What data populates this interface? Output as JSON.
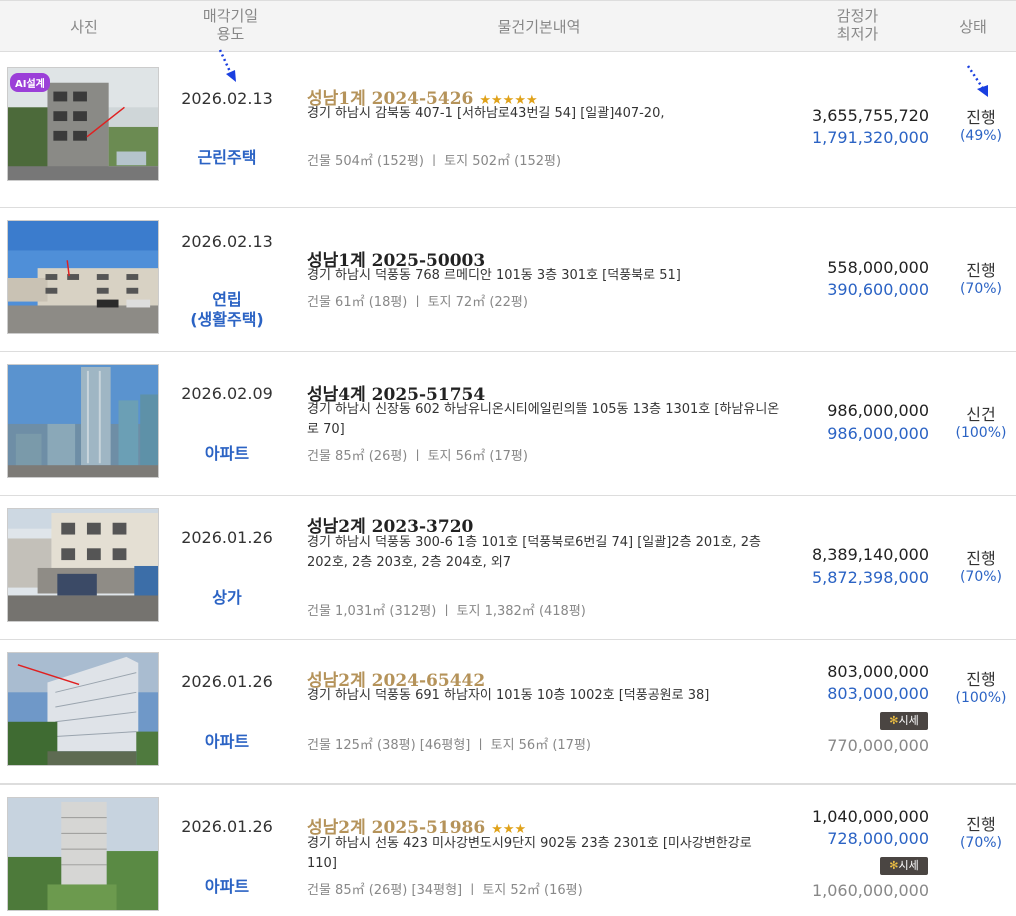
{
  "header": {
    "photo": "사진",
    "date_line1": "매각기일",
    "date_line2": "용도",
    "basic": "물건기본내역",
    "price_line1": "감정가",
    "price_line2": "최저가",
    "status": "상태"
  },
  "listings": [
    {
      "badge": "AI설계",
      "date": "2026.02.13",
      "usage": "근린주택",
      "case": "성남1계 2024-5426",
      "stars": "★★★★★",
      "address": "경기 하남시 감북동 407-1 [서하남로43번길 54]  [일괄]407-20,",
      "area": "건물 504㎡ (152평)   ㅣ  토지 502㎡ (152평)",
      "appraisal": "3,655,755,720",
      "min_price": "1,791,320,000",
      "status": "진행",
      "percent": "(49%)"
    },
    {
      "date": "2026.02.13",
      "usage_line1": "연립",
      "usage_line2": "(생활주택)",
      "case": "성남1계 2025-50003",
      "address": "경기 하남시 덕풍동 768 르메디안 101동 3층 301호 [덕풍북로 51]",
      "area": "건물 61㎡ (18평)   ㅣ  토지 72㎡ (22평)",
      "appraisal": "558,000,000",
      "min_price": "390,600,000",
      "status": "진행",
      "percent": "(70%)"
    },
    {
      "date": "2026.02.09",
      "usage": "아파트",
      "case": "성남4계 2025-51754",
      "address": "경기 하남시 신장동 602 하남유니온시티에일린의뜰 105동 13층 1301호 [하남유니온로 70]",
      "area": "건물 85㎡ (26평)   ㅣ  토지 56㎡ (17평)",
      "appraisal": "986,000,000",
      "min_price": "986,000,000",
      "status": "신건",
      "percent": "(100%)"
    },
    {
      "date": "2026.01.26",
      "usage": "상가",
      "case": "성남2계 2023-3720",
      "address": "경기 하남시 덕풍동 300-6 1층 101호 [덕풍북로6번길 74]  [일괄]2층 201호, 2층 202호, 2층 203호, 2층 204호, 외7",
      "area": "건물 1,031㎡ (312평)   ㅣ  토지 1,382㎡ (418평)",
      "appraisal": "8,389,140,000",
      "min_price": "5,872,398,000",
      "status": "진행",
      "percent": "(70%)"
    },
    {
      "date": "2026.01.26",
      "usage": "아파트",
      "case": "성남2계 2024-65442",
      "address": "경기 하남시 덕풍동 691 하남자이 101동 10층 1002호 [덕풍공원로 38]",
      "area": "건물 125㎡ (38평) [46평형]  ㅣ  토지 56㎡ (17평)",
      "appraisal": "803,000,000",
      "min_price": "803,000,000",
      "sise": "시세",
      "market_price": "770,000,000",
      "status": "진행",
      "percent": "(100%)"
    },
    {
      "date": "2026.01.26",
      "usage": "아파트",
      "case": "성남2계 2025-51986",
      "stars": "★★★",
      "address": "경기 하남시 선동 423 미사강변도시9단지 902동 23층 2301호 [미사강변한강로 110]",
      "area": "건물 85㎡ (26평) [34평형]  ㅣ  토지 52㎡ (16평)",
      "appraisal": "1,040,000,000",
      "min_price": "728,000,000",
      "sise": "시세",
      "market_price": "1,060,000,000",
      "status": "진행",
      "percent": "(70%)"
    }
  ]
}
